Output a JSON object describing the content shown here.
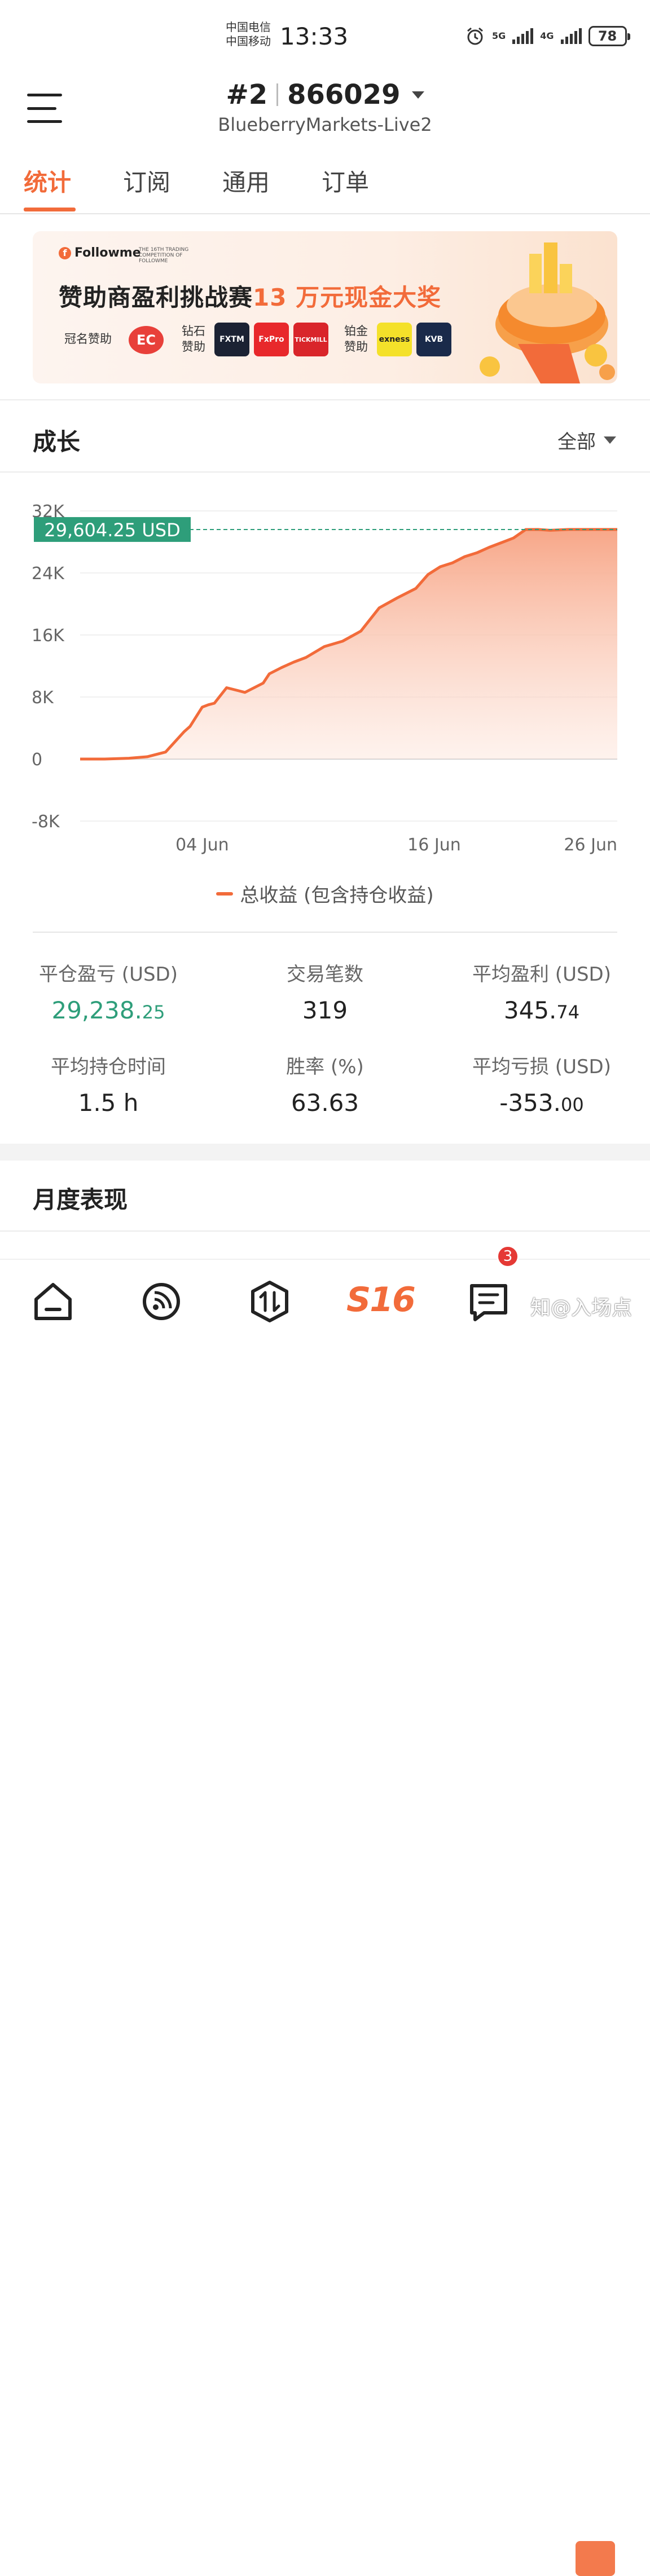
{
  "status_bar": {
    "carrier_1": "中国电信",
    "carrier_2": "中国移动",
    "time": "13:33",
    "net_1": "5G",
    "net_2": "4G",
    "battery": "78"
  },
  "header": {
    "account_number": "#2",
    "account_id": "866029",
    "server": "BlueberryMarkets-Live2"
  },
  "tabs": [
    {
      "label": "统计",
      "active": true
    },
    {
      "label": "订阅",
      "active": false
    },
    {
      "label": "通用",
      "active": false
    },
    {
      "label": "订单",
      "active": false
    }
  ],
  "banner": {
    "brand": "Followme",
    "competition_sub": "THE 16TH TRADING COMPETITION OF FOLLOWME",
    "title_prefix": "赞助商盈利挑战赛",
    "title_highlight": "13 万元现金大奖",
    "title_sponsor_label": "冠名赞助",
    "diamond_label_1": "钻石",
    "diamond_label_2": "赞助",
    "platinum_label_1": "铂金",
    "platinum_label_2": "赞助",
    "sponsors": {
      "title": "EC",
      "diamond": [
        "FXTM",
        "FxPro",
        "TICKMILL"
      ],
      "platinum": [
        "exness",
        "KVB"
      ]
    }
  },
  "growth": {
    "title": "成长",
    "range": "全部",
    "legend": "总收益 (包含持仓收益)"
  },
  "chart_data": {
    "type": "area",
    "series": [
      {
        "name": "总收益 (包含持仓收益)",
        "color": "#f26b3a",
        "x": [
          0,
          4,
          8,
          11,
          14,
          17,
          18,
          20,
          21,
          22,
          24,
          26,
          27,
          30,
          31,
          33,
          35,
          37,
          40,
          43,
          46,
          49,
          52,
          55,
          57,
          59,
          61,
          63,
          65,
          67,
          69,
          71,
          73,
          75,
          77,
          80,
          83,
          86,
          88
        ],
        "values": [
          0,
          0,
          100,
          300,
          900,
          3500,
          4200,
          6700,
          7000,
          7200,
          9200,
          8800,
          8600,
          9800,
          11000,
          11800,
          12500,
          13100,
          14500,
          15200,
          16500,
          19500,
          20800,
          22000,
          23800,
          24800,
          25300,
          26100,
          26600,
          27300,
          27900,
          28500,
          29600,
          29604.25,
          29500,
          29604.25,
          29604.25,
          29604.25,
          29604.25
        ]
      }
    ],
    "x_tick_labels": [
      "04 Jun",
      "16 Jun",
      "26 Jun"
    ],
    "x_tick_positions": [
      20,
      58,
      88
    ],
    "xlim": [
      0,
      88
    ],
    "y_tick_labels": [
      "32K",
      "24K",
      "16K",
      "8K",
      "0",
      "-8K"
    ],
    "ylim": [
      -8000,
      32000
    ],
    "current_value_label": "29,604.25 USD",
    "current_value": 29604.25,
    "grid": true,
    "fill_color": "#f9b49a",
    "label_color": "#2e9e7a"
  },
  "stats": [
    {
      "label": "平仓盈亏 (USD)",
      "value_main": "29,238.",
      "value_dec": "25",
      "green": true
    },
    {
      "label": "交易笔数",
      "value_main": "319",
      "value_dec": "",
      "green": false
    },
    {
      "label": "平均盈利 (USD)",
      "value_main": "345.",
      "value_dec": "74",
      "green": false
    },
    {
      "label": "平均持仓时间",
      "value_main": "1.5 h",
      "value_dec": "",
      "green": false
    },
    {
      "label": "胜率 (%)",
      "value_main": "63.63",
      "value_dec": "",
      "green": false
    },
    {
      "label": "平均亏损 (USD)",
      "value_main": "-353.",
      "value_dec": "00",
      "green": false
    }
  ],
  "monthly": {
    "title": "月度表现"
  },
  "bottom_nav": {
    "s16_label": "S16",
    "messages_badge": "3",
    "watermark": "知@入场点"
  }
}
